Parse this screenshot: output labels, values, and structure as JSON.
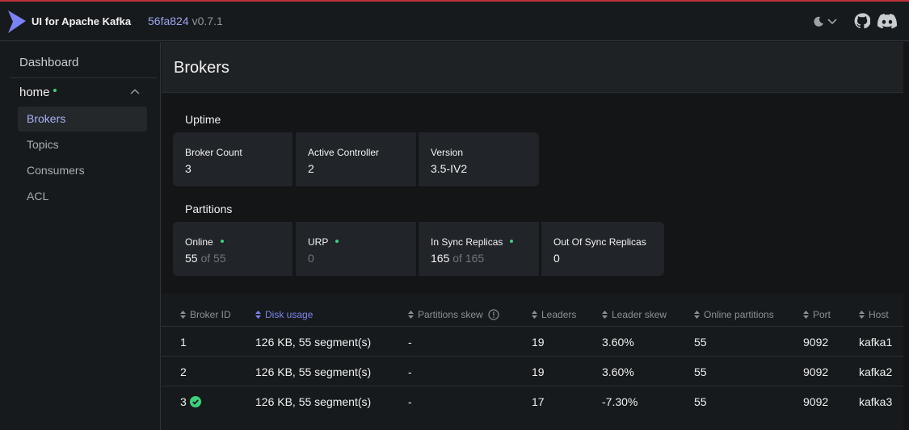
{
  "app": {
    "title": "UI for Apache Kafka",
    "commit": "56fa824",
    "version": "v0.7.1"
  },
  "sidebar": {
    "dashboard": "Dashboard",
    "cluster": "home",
    "items": [
      {
        "label": "Brokers",
        "active": true
      },
      {
        "label": "Topics",
        "active": false
      },
      {
        "label": "Consumers",
        "active": false
      },
      {
        "label": "ACL",
        "active": false
      }
    ]
  },
  "page": {
    "title": "Brokers"
  },
  "uptime": {
    "label": "Uptime",
    "cards": [
      {
        "label": "Broker Count",
        "value": "3"
      },
      {
        "label": "Active Controller",
        "value": "2"
      },
      {
        "label": "Version",
        "value": "3.5-IV2"
      }
    ]
  },
  "partitions": {
    "label": "Partitions",
    "cards": [
      {
        "label": "Online",
        "value": "55",
        "total": "of 55",
        "status": "ok"
      },
      {
        "label": "URP",
        "value": "0",
        "status": "ok"
      },
      {
        "label": "In Sync Replicas",
        "value": "165",
        "total": "of 165",
        "status": "ok"
      },
      {
        "label": "Out Of Sync Replicas",
        "value": "0"
      }
    ]
  },
  "table": {
    "columns": [
      "Broker ID",
      "Disk usage",
      "Partitions skew",
      "Leaders",
      "Leader skew",
      "Online partitions",
      "Port",
      "Host"
    ],
    "sorted_column": "Disk usage",
    "rows": [
      {
        "id": "1",
        "disk": "126 KB, 55 segment(s)",
        "skew": "-",
        "leaders": "19",
        "leader_skew": "3.60%",
        "online": "55",
        "port": "9092",
        "host": "kafka1",
        "controller": false
      },
      {
        "id": "2",
        "disk": "126 KB, 55 segment(s)",
        "skew": "-",
        "leaders": "19",
        "leader_skew": "3.60%",
        "online": "55",
        "port": "9092",
        "host": "kafka2",
        "controller": false
      },
      {
        "id": "3",
        "disk": "126 KB, 55 segment(s)",
        "skew": "-",
        "leaders": "17",
        "leader_skew": "-7.30%",
        "online": "55",
        "port": "9092",
        "host": "kafka3",
        "controller": true
      }
    ]
  },
  "colors": {
    "accent": "#7c84f0",
    "ok": "#3dd17c",
    "top_line": "#c0303f"
  }
}
